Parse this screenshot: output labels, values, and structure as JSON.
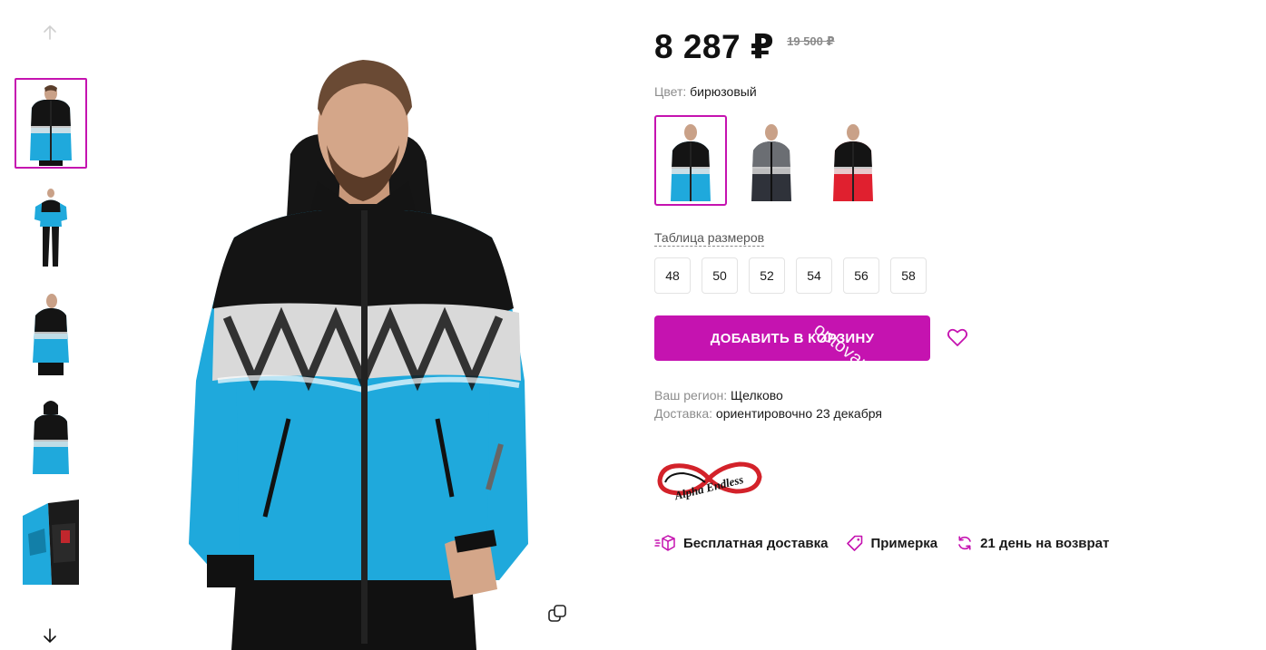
{
  "gallery": {
    "thumbnails": [
      {
        "name": "thumb-front",
        "active": true
      },
      {
        "name": "thumb-full-body"
      },
      {
        "name": "thumb-side"
      },
      {
        "name": "thumb-back"
      },
      {
        "name": "thumb-inside"
      }
    ],
    "up_icon": "arrow-up-icon",
    "down_icon": "arrow-down-icon",
    "copy_icon": "copy-icon"
  },
  "product": {
    "price": "8 287 ₽",
    "old_price": "19 500 ₽",
    "color_label": "Цвет:",
    "color_value": "бирюзовый",
    "swatches": [
      {
        "name": "swatch-turquoise",
        "body": "#1fa9dc",
        "active": true
      },
      {
        "name": "swatch-grey",
        "body": "#3a3d45"
      },
      {
        "name": "swatch-red",
        "body": "#e0202f"
      }
    ],
    "size_table_label": "Таблица размеров",
    "sizes": [
      "48",
      "50",
      "52",
      "54",
      "56",
      "58"
    ],
    "add_to_cart_label": "ДОБАВИТЬ В КОРЗИНУ",
    "watermark_text": "optovaro",
    "wishlist_icon": "heart-icon"
  },
  "shipping": {
    "region_label": "Ваш регион:",
    "region_value": "Щелково",
    "delivery_label": "Доставка:",
    "delivery_value": "ориентировочно 23 декабря"
  },
  "brand": {
    "logo_text": "Alpha Endless"
  },
  "perks": [
    {
      "icon": "delivery-box-icon",
      "label": "Бесплатная доставка"
    },
    {
      "icon": "tag-icon",
      "label": "Примерка"
    },
    {
      "icon": "return-icon",
      "label": "21 день на возврат"
    }
  ],
  "colors": {
    "accent": "#c513b0",
    "jacket_blue": "#1fa9dc",
    "jacket_black": "#141414"
  }
}
